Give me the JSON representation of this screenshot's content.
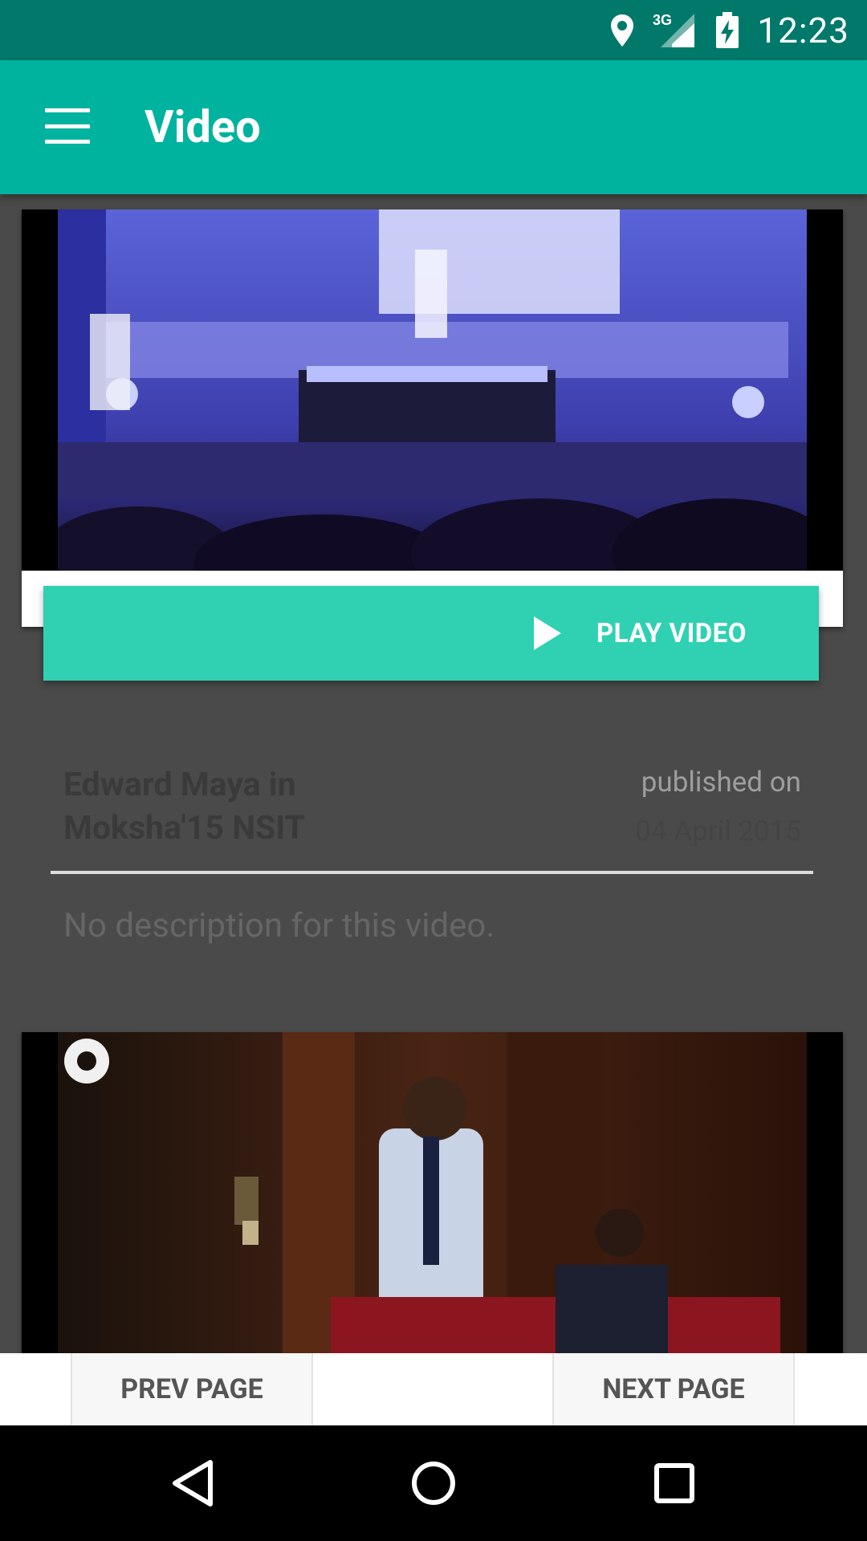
{
  "status_bar": {
    "time": "12:23",
    "network": "3G",
    "icons": [
      "location-icon",
      "signal-3g-icon",
      "battery-charging-icon"
    ]
  },
  "app_bar": {
    "title": "Video",
    "menu_icon": "hamburger-menu-icon"
  },
  "videos": [
    {
      "title": "Edward Maya in Moksha'15 NSIT",
      "published_label": "published on",
      "published_date": "04 April 2015",
      "play_label": "PLAY VIDEO",
      "description": "No description for this video."
    }
  ],
  "paging": {
    "prev_label": "PREV PAGE",
    "next_label": "NEXT PAGE"
  },
  "nav_bar": {
    "icons": [
      "back-icon",
      "home-icon",
      "recent-apps-icon"
    ]
  },
  "colors": {
    "status_bar": "#00796b",
    "app_bar": "#00b39e",
    "play_button": "#2fd1b2",
    "background": "#4a4a4a"
  }
}
